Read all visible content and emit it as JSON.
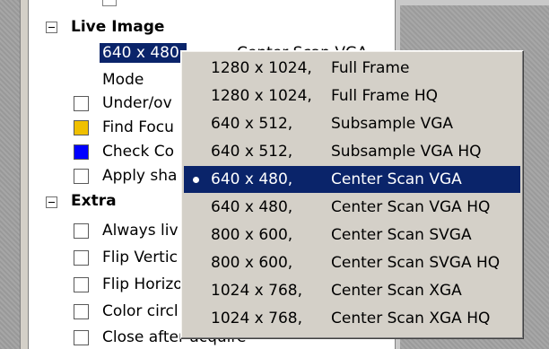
{
  "tree": {
    "live_image": {
      "label": "Live Image",
      "resolution_value": "640 x 480,",
      "resolution_mode_hidden": "Center Scan VGA",
      "items": [
        {
          "label": "Mode"
        },
        {
          "label": "Under/ov",
          "checkbox_color": "#ffffff"
        },
        {
          "label": "Find Focu",
          "checkbox_color": "#f0c000"
        },
        {
          "label": "Check Co",
          "checkbox_color": "#0000ff"
        },
        {
          "label": "Apply sha",
          "checkbox_color": "#ffffff"
        }
      ]
    },
    "extra": {
      "label": "Extra",
      "items": [
        {
          "label": "Always liv"
        },
        {
          "label": "Flip Vertic"
        },
        {
          "label": "Flip Horizo"
        },
        {
          "label": "Color circl"
        },
        {
          "label": "Close after acquire"
        }
      ]
    }
  },
  "menu": {
    "selected_index": 4,
    "items": [
      {
        "resolution": "1280 x 1024,",
        "mode": "Full Frame"
      },
      {
        "resolution": "1280 x 1024,",
        "mode": "Full Frame HQ"
      },
      {
        "resolution": "640 x 512,",
        "mode": "Subsample VGA"
      },
      {
        "resolution": "640 x 512,",
        "mode": "Subsample VGA HQ"
      },
      {
        "resolution": "640 x 480,",
        "mode": "Center Scan VGA"
      },
      {
        "resolution": "640 x 480,",
        "mode": "Center Scan VGA HQ"
      },
      {
        "resolution": "800 x 600,",
        "mode": "Center Scan SVGA"
      },
      {
        "resolution": "800 x 600,",
        "mode": "Center Scan SVGA HQ"
      },
      {
        "resolution": "1024 x 768,",
        "mode": "Center Scan XGA"
      },
      {
        "resolution": "1024 x 768,",
        "mode": "Center Scan XGA HQ"
      }
    ]
  },
  "colors": {
    "selection": "#0a246a",
    "menu_bg": "#d4d0c8",
    "panel_bg": "#ffffff"
  }
}
